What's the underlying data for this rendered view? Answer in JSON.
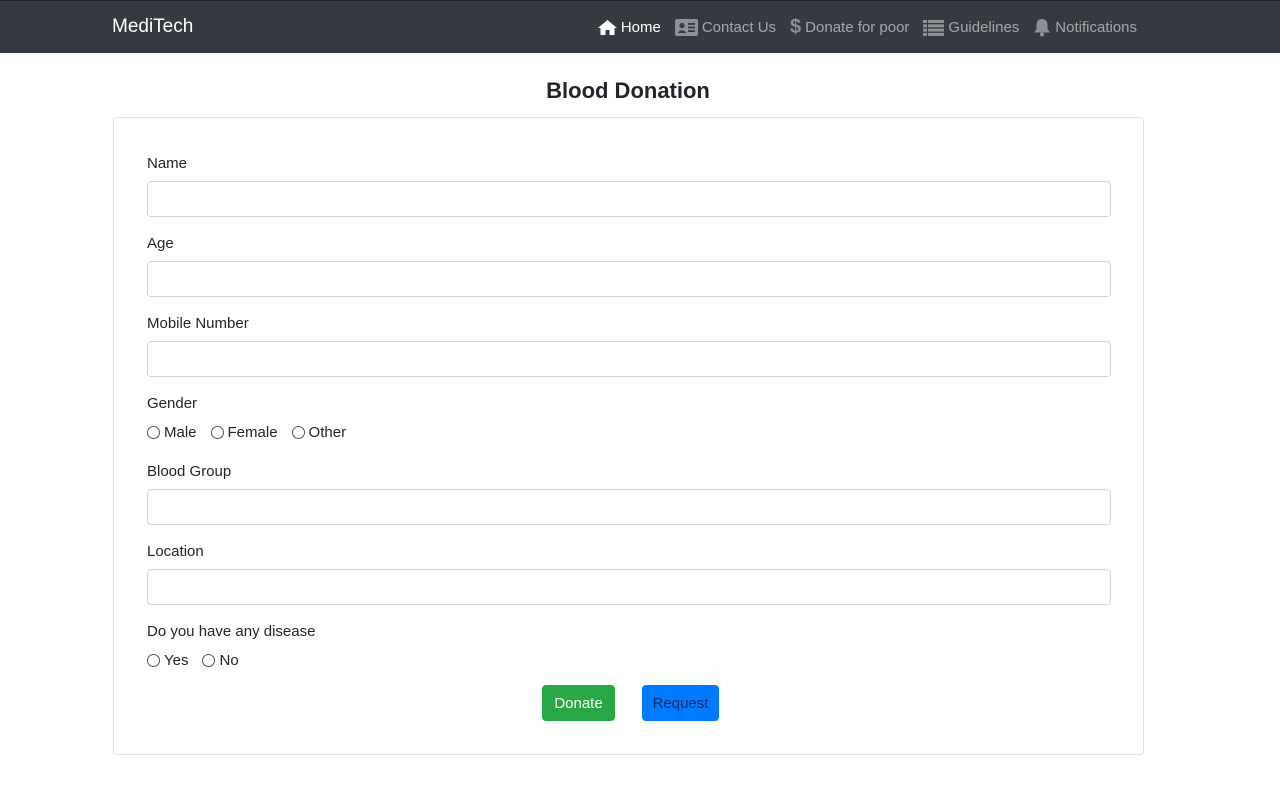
{
  "navbar": {
    "brand": "MediTech",
    "items": [
      {
        "label": "Home",
        "icon": "home-icon",
        "active": true
      },
      {
        "label": "Contact Us",
        "icon": "contact-card-icon",
        "active": false
      },
      {
        "label": "Donate for poor",
        "icon": "dollar-icon",
        "active": false
      },
      {
        "label": "Guidelines",
        "icon": "list-icon",
        "active": false
      },
      {
        "label": "Notifications",
        "icon": "bell-icon",
        "active": false
      }
    ]
  },
  "page": {
    "title": "Blood Donation"
  },
  "form": {
    "name_label": "Name",
    "name_value": "",
    "age_label": "Age",
    "age_value": "",
    "mobile_label": "Mobile Number",
    "mobile_value": "",
    "gender_label": "Gender",
    "gender_options": [
      "Male",
      "Female",
      "Other"
    ],
    "blood_group_label": "Blood Group",
    "blood_group_value": "",
    "location_label": "Location",
    "location_value": "",
    "disease_label": "Do you have any disease",
    "disease_options": [
      "Yes",
      "No"
    ],
    "donate_button": "Donate",
    "request_button": "Request"
  },
  "colors": {
    "navbar_bg": "#343a40",
    "donate_green": "#28a745",
    "request_blue": "#007bff"
  }
}
